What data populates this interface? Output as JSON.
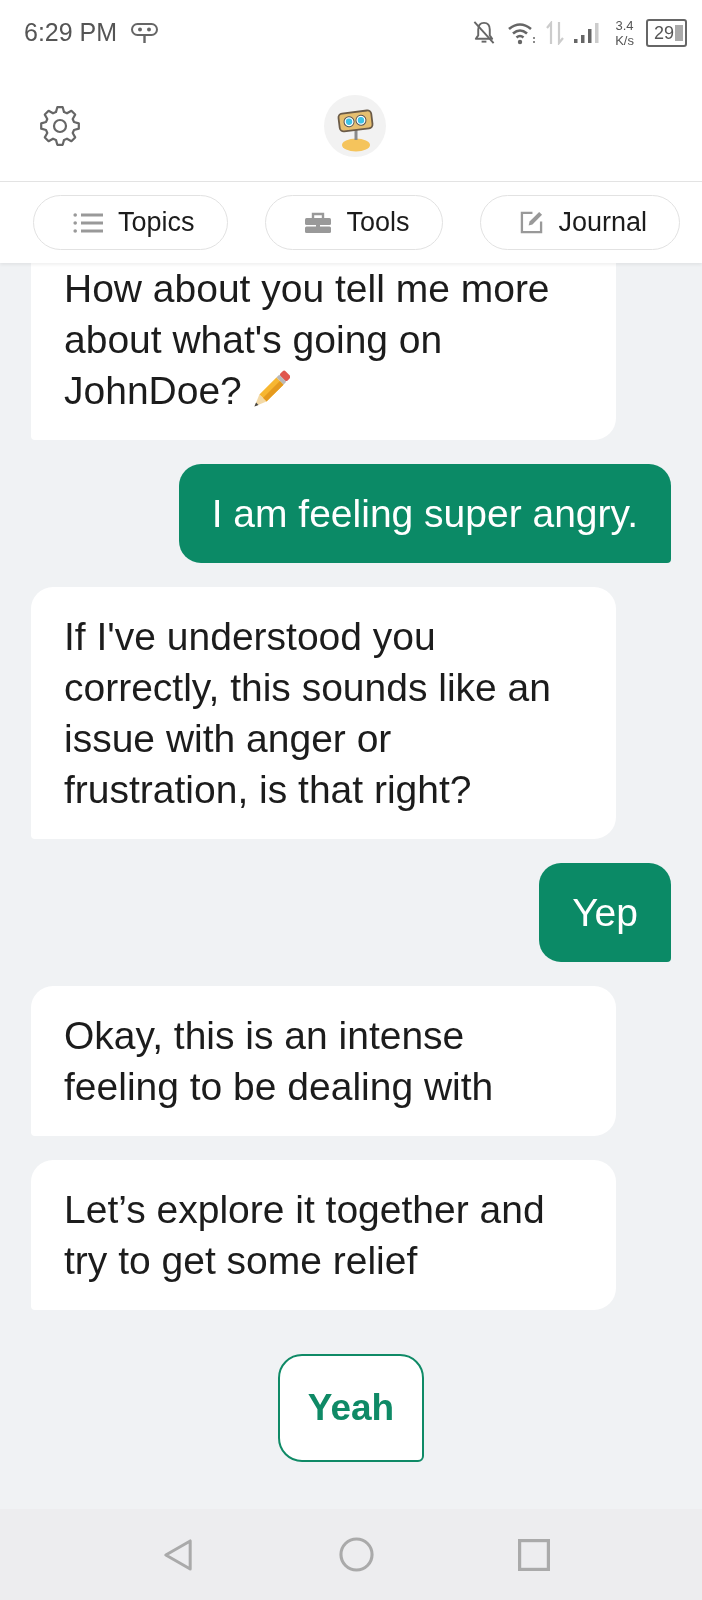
{
  "status_bar": {
    "time": "6:29 PM",
    "net_speed": "3.4",
    "net_speed_unit": "K/s",
    "battery": "29"
  },
  "chips": [
    {
      "kind": "list",
      "label": "Topics"
    },
    {
      "kind": "toolbox",
      "label": "Tools"
    },
    {
      "kind": "edit",
      "label": "Journal"
    }
  ],
  "messages": [
    {
      "kind": "bot",
      "lines": [
        "How about you tell me more",
        "about what's going on",
        "JohnDoe?"
      ],
      "emoji": true
    },
    {
      "kind": "user",
      "lines": [
        "I am feeling super angry."
      ],
      "emoji": false
    },
    {
      "kind": "bot",
      "lines": [
        "If I've understood you",
        "correctly, this sounds like an",
        "issue with anger or",
        "frustration, is that right?"
      ],
      "emoji": false
    },
    {
      "kind": "user",
      "lines": [
        "Yep"
      ],
      "emoji": false
    },
    {
      "kind": "bot",
      "lines": [
        "Okay, this is an intense",
        "feeling to be dealing with"
      ],
      "emoji": false
    },
    {
      "kind": "bot",
      "lines": [
        "Let’s explore it together and",
        "try to get some relief"
      ],
      "emoji": false
    }
  ],
  "quick_replies": [
    "Yeah"
  ]
}
